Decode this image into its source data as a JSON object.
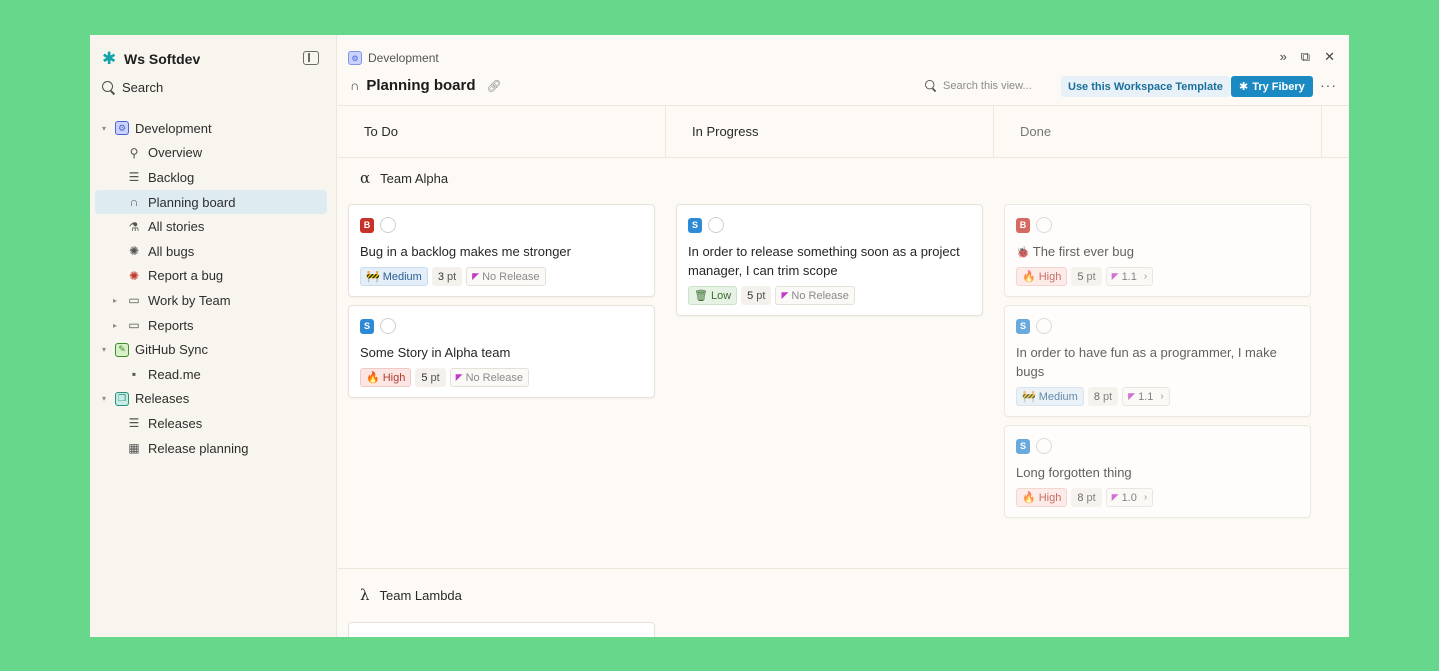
{
  "workspace": {
    "name": "Ws Softdev"
  },
  "sidebar": {
    "search_label": "Search",
    "items": [
      {
        "label": "Development",
        "level": 0,
        "caret": "▾",
        "icon": "db",
        "color": "#4c63d8",
        "bg": "#c9d3fb",
        "glyph": "⚙"
      },
      {
        "label": "Overview",
        "level": 1,
        "icon": "⚲"
      },
      {
        "label": "Backlog",
        "level": 1,
        "icon": "☰"
      },
      {
        "label": "Planning board",
        "level": 1,
        "icon": "∩",
        "active": true
      },
      {
        "label": "All stories",
        "level": 1,
        "icon": "⚗"
      },
      {
        "label": "All bugs",
        "level": 1,
        "icon": "✺"
      },
      {
        "label": "Report a bug",
        "level": 1,
        "icon": "✺",
        "icon_color": "#c0392b"
      },
      {
        "label": "Work by Team",
        "level": 1,
        "caret": "▸",
        "icon": "▭"
      },
      {
        "label": "Reports",
        "level": 1,
        "caret": "▸",
        "icon": "▭"
      },
      {
        "label": "GitHub Sync",
        "level": 0,
        "caret": "▾",
        "icon": "db",
        "color": "#3e8c2a",
        "bg": "#d8efc9",
        "glyph": "✎"
      },
      {
        "label": "Read.me",
        "level": 1,
        "icon": "▪"
      },
      {
        "label": "Releases",
        "level": 0,
        "caret": "▾",
        "icon": "db",
        "color": "#2a8f7e",
        "bg": "#c6ece3",
        "glyph": "❒"
      },
      {
        "label": "Releases",
        "level": 1,
        "icon": "☰"
      },
      {
        "label": "Release planning",
        "level": 1,
        "icon": "▦"
      }
    ]
  },
  "header": {
    "breadcrumb": "Development",
    "title": "Planning board",
    "search_placeholder": "Search this view...",
    "template_button": "Use this Workspace Template",
    "try_button": "Try Fibery"
  },
  "columns": [
    "To Do",
    "In Progress",
    "Done"
  ],
  "groups": [
    {
      "glyph": "α",
      "name": "Team Alpha"
    },
    {
      "glyph": "λ",
      "name": "Team Lambda"
    }
  ],
  "colors": {
    "bug": "#c7332a",
    "story": "#2f8ad6",
    "accent": "#1c8ac2"
  },
  "cards": [
    {
      "type": "B",
      "title": "Bug in a backlog makes me stronger",
      "priority": "Medium",
      "points": "3",
      "pt_unit": "pt",
      "release": "No Release"
    },
    {
      "type": "S",
      "title": "Some Story in Alpha team",
      "priority": "High",
      "points": "5",
      "pt_unit": "pt",
      "release": "No Release"
    },
    {
      "type": "S",
      "title": "In order to release something soon as a project manager, I can trim scope",
      "priority": "Low",
      "points": "5",
      "pt_unit": "pt",
      "release": "No Release"
    },
    {
      "type": "B",
      "title": "The first ever bug",
      "priority": "High",
      "points": "5",
      "pt_unit": "pt",
      "release": "1.1"
    },
    {
      "type": "S",
      "title": "In order to have fun as a programmer, I make bugs",
      "priority": "Medium",
      "points": "8",
      "pt_unit": "pt",
      "release": "1.1"
    },
    {
      "type": "S",
      "title": "Long forgotten thing",
      "priority": "High",
      "points": "8",
      "pt_unit": "pt",
      "release": "1.0"
    }
  ]
}
